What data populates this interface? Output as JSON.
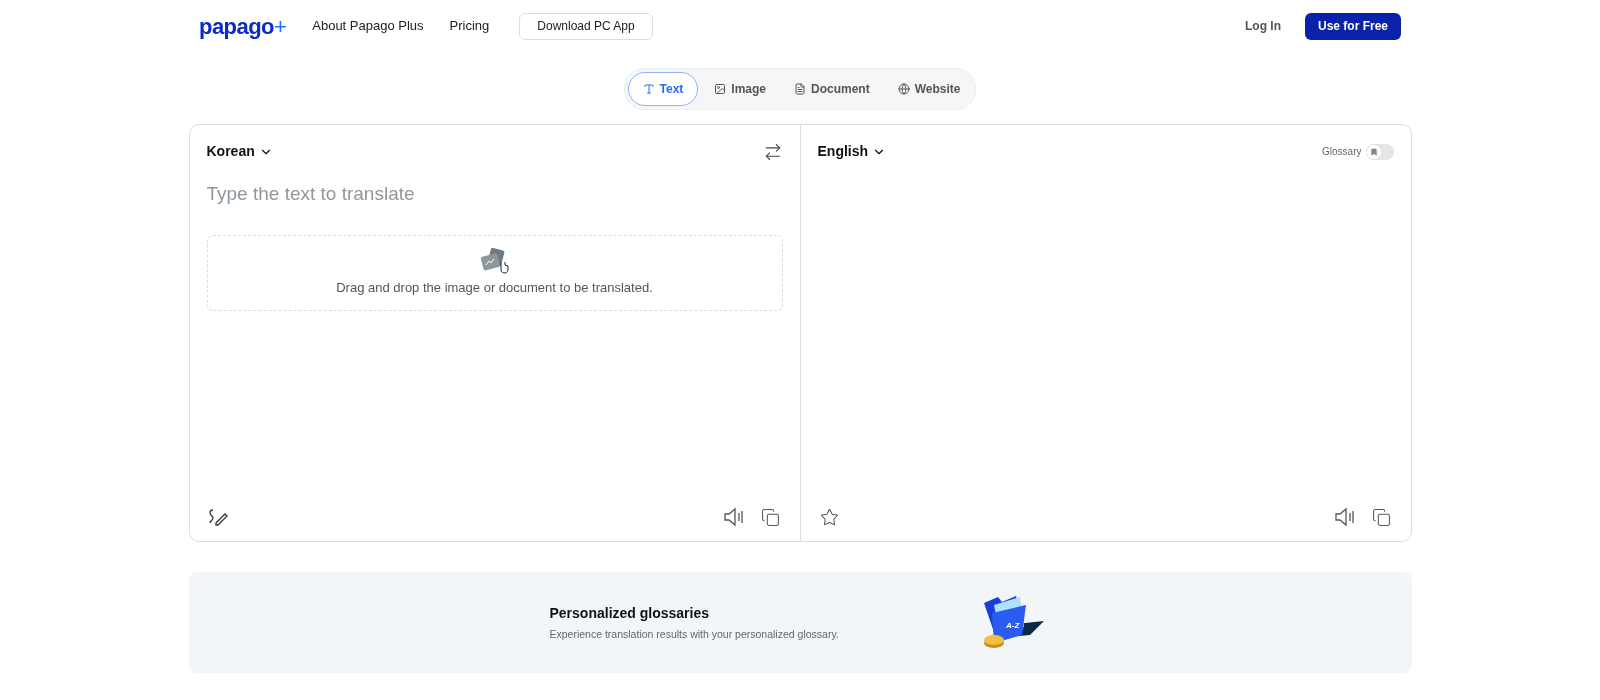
{
  "header": {
    "logo": "papago",
    "logo_mark": "+",
    "nav": [
      "About Papago Plus",
      "Pricing"
    ],
    "download_button": "Download PC App",
    "login": "Log In",
    "cta": "Use for Free"
  },
  "tabs": [
    {
      "label": "Text",
      "selected": true
    },
    {
      "label": "Image",
      "selected": false
    },
    {
      "label": "Document",
      "selected": false
    },
    {
      "label": "Website",
      "selected": false
    }
  ],
  "source": {
    "language": "Korean",
    "placeholder": "Type the text to translate",
    "drop_hint": "Drag and drop the image or document to be translated."
  },
  "target": {
    "language": "English",
    "glossary": {
      "label": "Glossary",
      "on": false
    }
  },
  "banner": {
    "title": "Personalized glossaries",
    "text": "Experience translation results with your personalized glossary.",
    "art_label": "A-Z"
  }
}
